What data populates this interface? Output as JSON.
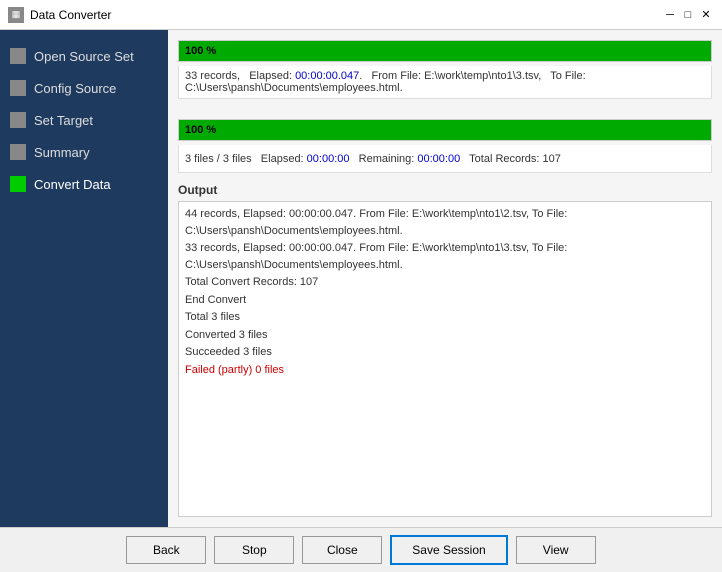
{
  "window": {
    "title": "Data Converter"
  },
  "titlebar": {
    "minimize": "─",
    "maximize": "□",
    "close": "✕"
  },
  "sidebar": {
    "items": [
      {
        "id": "open-source-set",
        "label": "Open Source Set",
        "icon": "gray",
        "active": false
      },
      {
        "id": "config-source",
        "label": "Config Source",
        "icon": "gray",
        "active": false
      },
      {
        "id": "set-target",
        "label": "Set Target",
        "icon": "gray",
        "active": false
      },
      {
        "id": "summary",
        "label": "Summary",
        "icon": "gray",
        "active": false
      },
      {
        "id": "convert-data",
        "label": "Convert Data",
        "icon": "green",
        "active": true
      }
    ]
  },
  "progress1": {
    "percent": "100 %",
    "fill_width": "100%",
    "info": "33 records,   Elapsed: 00:00:00.047.   From File: E:\\work\\temp\\nto1\\3.tsv,   To File: C:\\Users\\pansh\\Documents\\employees.html."
  },
  "progress2": {
    "percent": "100 %",
    "fill_width": "100%",
    "info": "3 files / 3 files   Elapsed: 00:00:00   Remaining: 00:00:00   Total Records: 107"
  },
  "output": {
    "label": "Output",
    "lines": [
      {
        "text": "44 records,   Elapsed: 00:00:00.047.   From File: E:\\work\\temp\\nto1\\2.tsv,   To File: C:\\Users\\pansh\\Documents\\employees.html.",
        "type": "normal"
      },
      {
        "text": "33 records,   Elapsed: 00:00:00.047.   From File: E:\\work\\temp\\nto1\\3.tsv,   To File: C:\\Users\\pansh\\Documents\\employees.html.",
        "type": "normal"
      },
      {
        "text": "Total Convert Records: 107",
        "type": "normal"
      },
      {
        "text": "End Convert",
        "type": "normal"
      },
      {
        "text": "Total 3 files",
        "type": "normal"
      },
      {
        "text": "Converted 3 files",
        "type": "normal"
      },
      {
        "text": "Succeeded 3 files",
        "type": "normal"
      },
      {
        "text": "Failed (partly) 0 files",
        "type": "red"
      }
    ]
  },
  "footer": {
    "back_label": "Back",
    "stop_label": "Stop",
    "close_label": "Close",
    "save_session_label": "Save Session",
    "view_label": "View"
  }
}
